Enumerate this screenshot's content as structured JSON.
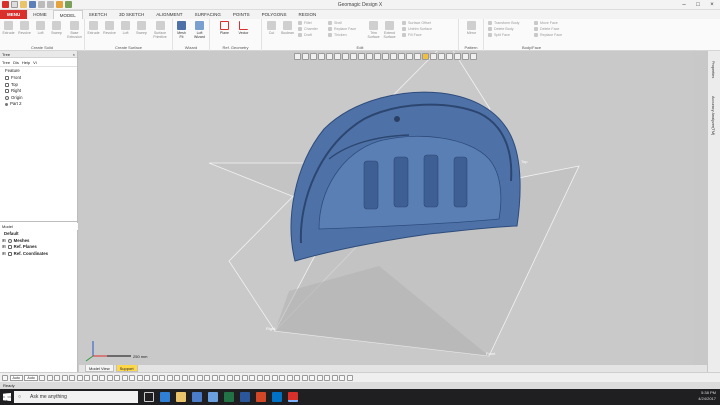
{
  "window": {
    "title": "Geomagic Design X"
  },
  "ribbon_tabs": [
    "MENU",
    "HOME",
    "MODEL",
    "SKETCH",
    "3D SKETCH",
    "ALIGNMENT",
    "SURFACING",
    "POINTS",
    "POLYGONS",
    "REGION"
  ],
  "active_tab": "MODEL",
  "ribbon": {
    "groups": {
      "create_solid": "Create Solid",
      "create_surface": "Create Surface",
      "wizard": "Wizard",
      "ref_geometry": "Ref. Geometry",
      "edit": "Edit",
      "pattern": "Pattern",
      "body_face": "Body/Face"
    },
    "buttons": {
      "extrude_1": "Extrude",
      "revolve_1": "Revolve",
      "loft_1": "Loft",
      "sweep_1": "Sweep",
      "base_1": "Base Extrusion",
      "extrude_2": "Extrude",
      "revolve_2": "Revolve",
      "loft_2": "Loft",
      "sweep_2": "Sweep",
      "surface_primitive": "Surface Primitive",
      "mesh_fit": "Mesh Fit",
      "loft_wizard": "Loft Wizard",
      "plane": "Plane",
      "vector": "Vector",
      "cut": "Cut",
      "boolean": "Boolean",
      "fillet": "Fillet",
      "chamfer": "Chamfer",
      "draft": "Draft",
      "shell": "Shell",
      "replace_face": "Replace Face",
      "thicken": "Thicken",
      "trim_surface": "Trim Surface",
      "extend_surface": "Extend Surface",
      "surface_offset": "Surface Offset",
      "untrim_surface": "Untrim Surface",
      "fill_face": "Fill Face",
      "mirror": "Mirror",
      "transform_body": "Transform Body",
      "delete_body": "Delete Body",
      "split_face": "Split Face",
      "move_face": "Move Face",
      "delete_face": "Delete Face",
      "replace_face_2": "Replace Face"
    }
  },
  "tree_pane": {
    "title": "Tree",
    "toolbar": [
      "Tree",
      "Dis",
      "Help",
      "Vi"
    ],
    "feature_label": "Feature",
    "items": [
      "Front",
      "Top",
      "Right",
      "Origin",
      "Part 2"
    ]
  },
  "model_pane": {
    "title": "Model",
    "root": "Default",
    "items": [
      "Meshes",
      "Ref. Planes",
      "Ref. Coordinates"
    ]
  },
  "viewport": {
    "plane_labels": [
      "Top",
      "Right",
      "Front"
    ],
    "scale_label": "250 mm"
  },
  "right_strip": {
    "tabs": [
      "Properties",
      "Accuracy Analyzer(TM)"
    ]
  },
  "model_view_tabs": [
    "Model View",
    "Support"
  ],
  "bottom_toolbar": {
    "select_1": "Auto",
    "select_2": "Auto"
  },
  "status": {
    "text": "Ready"
  },
  "taskbar": {
    "search_placeholder": "Ask me anything",
    "time": "5:38 PM",
    "date": "4/24/2017"
  },
  "colors": {
    "menu_red": "#d9302c",
    "mesh_blue": "#4e72a8",
    "support_tab": "#ffd84a"
  }
}
